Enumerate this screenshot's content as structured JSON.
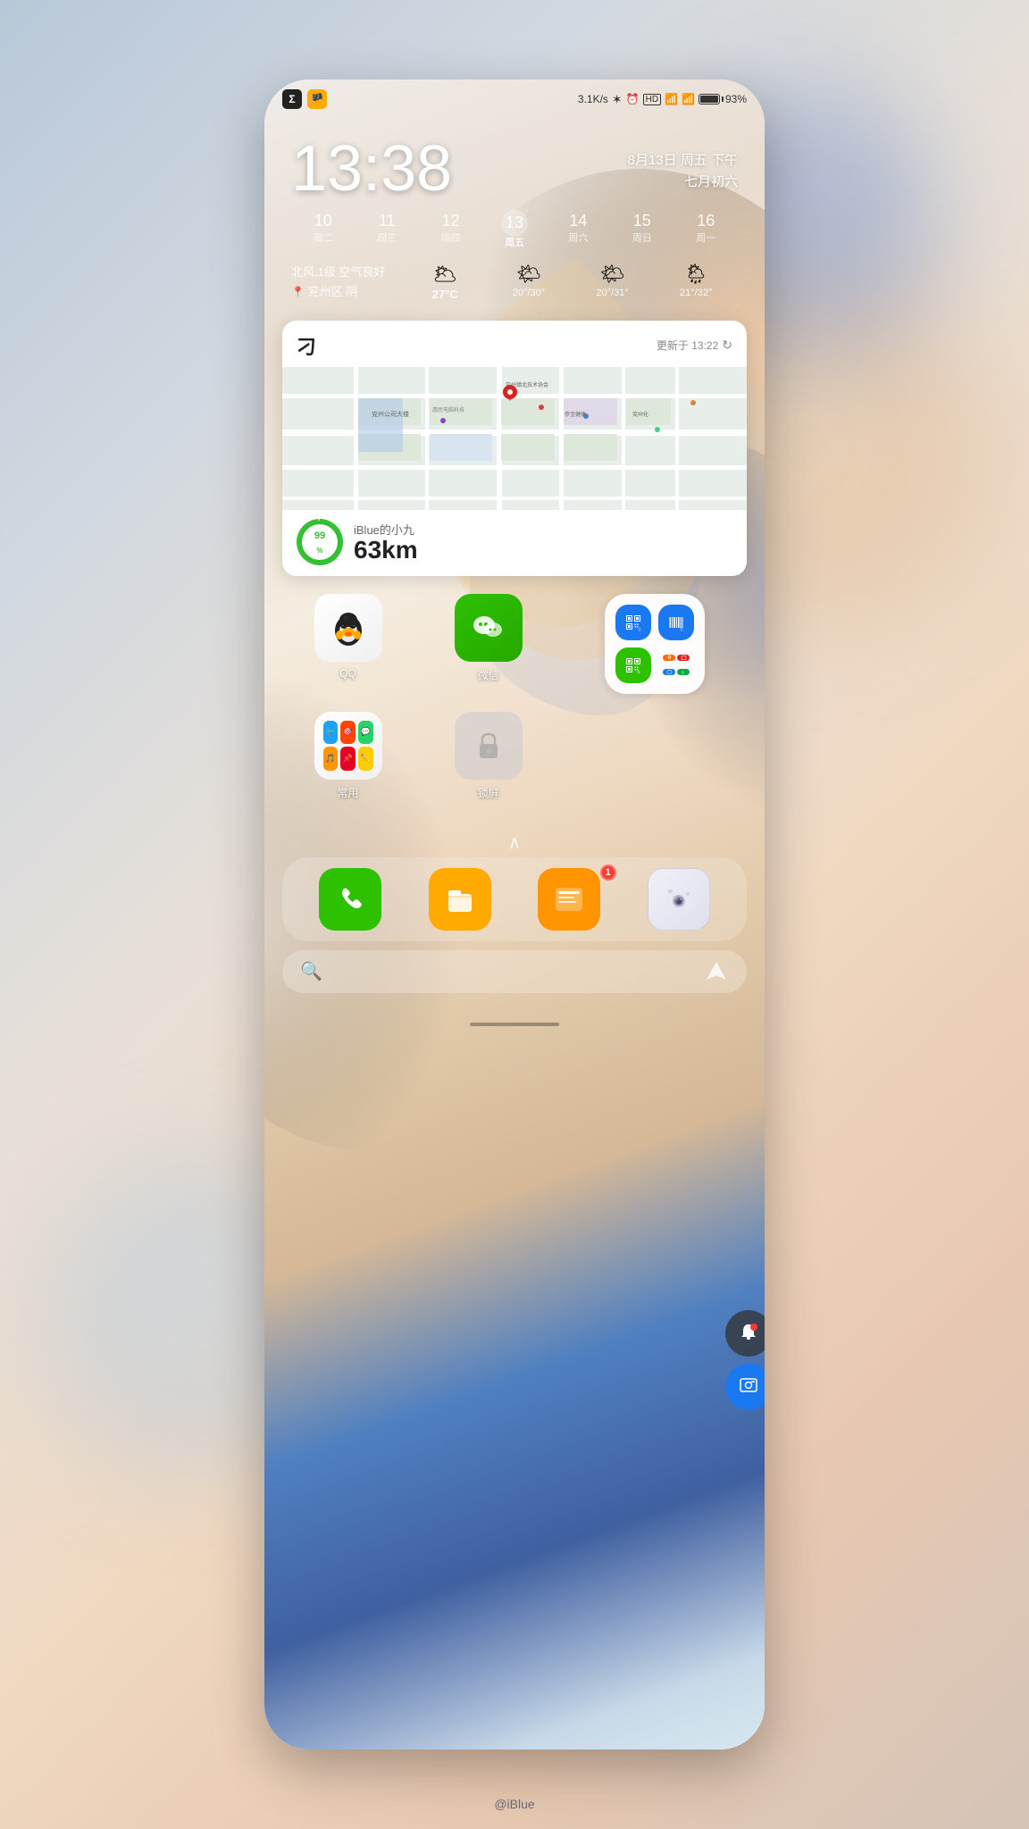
{
  "phone": {
    "statusBar": {
      "speed": "3.1K/s",
      "battery": "93%",
      "leftIcons": [
        "Σ",
        "🏴"
      ]
    },
    "clock": {
      "time": "13:38",
      "dateRight1": "8月13日 周五 下午",
      "dateRight2": "七月初六"
    },
    "calendar": {
      "days": [
        {
          "num": "10",
          "label": "周二"
        },
        {
          "num": "11",
          "label": "周三"
        },
        {
          "num": "12",
          "label": "周四"
        },
        {
          "num": "13",
          "label": "周五",
          "today": true
        },
        {
          "num": "14",
          "label": "周六"
        },
        {
          "num": "15",
          "label": "周日"
        },
        {
          "num": "16",
          "label": "周一"
        }
      ]
    },
    "weather": {
      "wind": "北风,1级 空气良好",
      "location": "兖州区 阴",
      "days": [
        {
          "icon": "🌥",
          "temp": "27°C",
          "today": true
        },
        {
          "icon": "🌤",
          "temp": "20°/30°"
        },
        {
          "icon": "🌤",
          "temp": "20°/31°"
        },
        {
          "icon": "🌦",
          "temp": "21°/32°"
        }
      ]
    },
    "mapWidget": {
      "logo": "刁",
      "updated": "更新于 13:22",
      "progress": "99%",
      "name": "iBlue的小九",
      "distance": "63km"
    },
    "apps": {
      "row1": [
        {
          "label": "QQ",
          "iconType": "qq"
        },
        {
          "label": "微信",
          "iconType": "wechat"
        },
        {
          "label": "",
          "iconType": "folder"
        }
      ],
      "row2": [
        {
          "label": "常用",
          "iconType": "changeyong"
        },
        {
          "label": "锁屏",
          "iconType": "suoping"
        },
        {
          "label": "",
          "iconType": "scan_folder"
        }
      ]
    },
    "dock": {
      "chevron": "∧",
      "apps": [
        {
          "label": "",
          "iconType": "phone",
          "color": "#2dc100"
        },
        {
          "label": "",
          "iconType": "files",
          "color": "#ffaa00"
        },
        {
          "label": "",
          "iconType": "marquee",
          "color": "#ff9500",
          "badge": "1"
        },
        {
          "label": "",
          "iconType": "camera",
          "color": "#f0f0f8"
        }
      ]
    },
    "searchBar": {
      "searchIcon": "🔍",
      "navIcon": "⌂"
    },
    "watermark": "@iBlue",
    "floatButtons": {
      "notif": "🔔",
      "screenshot": "📷"
    }
  }
}
